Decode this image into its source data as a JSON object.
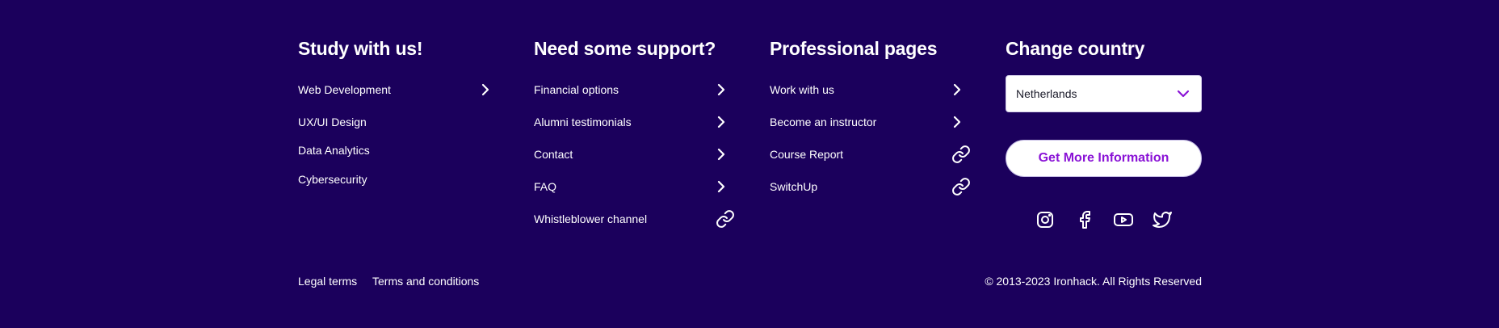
{
  "colors": {
    "background": "#1b005c",
    "accent": "#8a13d6",
    "text": "#ffffff"
  },
  "columns": [
    {
      "title": "Study with us!",
      "items": [
        {
          "label": "Web Development",
          "icon": "chevron-right-icon"
        },
        {
          "label": "UX/UI Design",
          "icon": ""
        },
        {
          "label": "Data Analytics",
          "icon": ""
        },
        {
          "label": "Cybersecurity",
          "icon": ""
        }
      ]
    },
    {
      "title": "Need some support?",
      "items": [
        {
          "label": "Financial options",
          "icon": "chevron-right-icon"
        },
        {
          "label": "Alumni testimonials",
          "icon": "chevron-right-icon"
        },
        {
          "label": "Contact",
          "icon": "chevron-right-icon"
        },
        {
          "label": "FAQ",
          "icon": "chevron-right-icon"
        },
        {
          "label": "Whistleblower channel",
          "icon": "external-link-icon"
        }
      ]
    },
    {
      "title": "Professional pages",
      "items": [
        {
          "label": "Work with us",
          "icon": "chevron-right-icon"
        },
        {
          "label": "Become an instructor",
          "icon": "chevron-right-icon"
        },
        {
          "label": "Course Report",
          "icon": "external-link-icon"
        },
        {
          "label": "SwitchUp",
          "icon": "external-link-icon"
        }
      ]
    }
  ],
  "country": {
    "title": "Change country",
    "selected": "Netherlands",
    "icon": "chevron-down-icon"
  },
  "cta": {
    "label": "Get More Information"
  },
  "social": [
    "instagram-icon",
    "facebook-icon",
    "youtube-icon",
    "twitter-icon"
  ],
  "bottom": {
    "legal_terms": "Legal terms",
    "terms_conditions": "Terms and conditions",
    "copyright": "© 2013-2023 Ironhack. All Rights Reserved"
  }
}
